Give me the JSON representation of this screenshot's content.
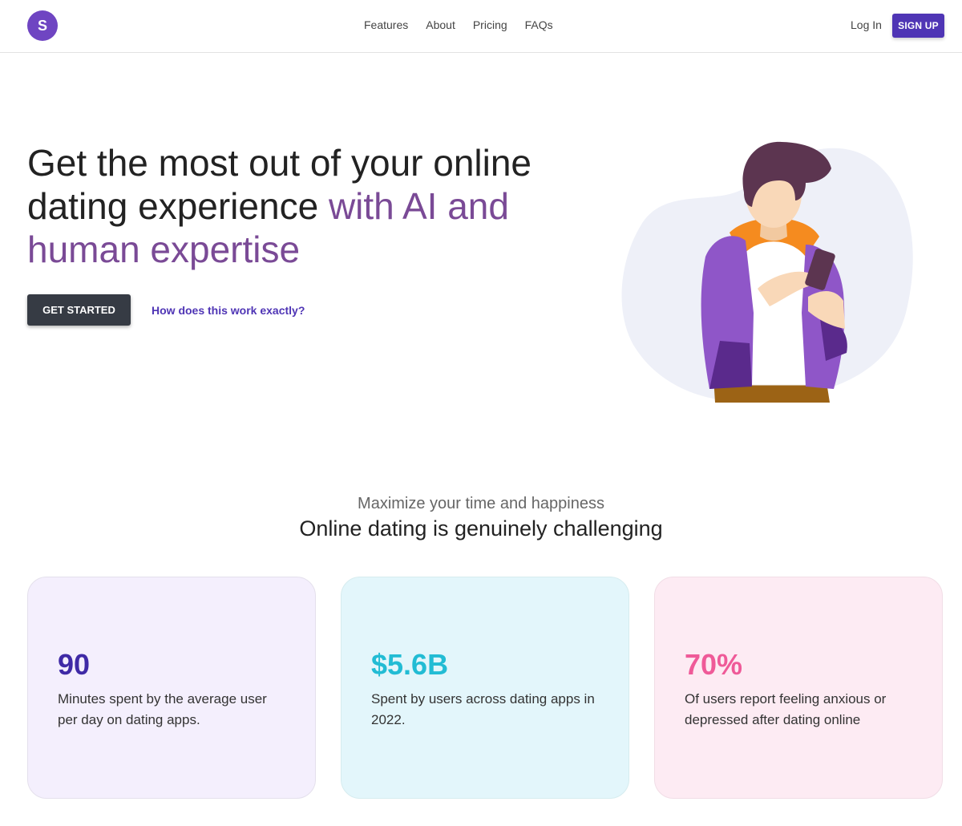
{
  "brand": {
    "logo_letter": "S",
    "accent_color": "#6f45c2"
  },
  "nav": {
    "links": [
      "Features",
      "About",
      "Pricing",
      "FAQs"
    ],
    "login_label": "Log In",
    "signup_label": "SIGN UP"
  },
  "hero": {
    "title_plain": "Get the most out of your online dating experience ",
    "title_accent": "with AI and human expertise",
    "cta_label": "GET STARTED",
    "secondary_link": "How does this work exactly?",
    "illustration": "person-holding-phone-illustration"
  },
  "section": {
    "subtitle": "Maximize your time and happiness",
    "title": "Online dating is genuinely challenging"
  },
  "stats": [
    {
      "value": "90",
      "text": "Minutes spent by the average user per day on dating apps.",
      "color": "#3f2aa6"
    },
    {
      "value": "$5.6B",
      "text": "Spent by users across dating apps in 2022.",
      "color": "#22bcd4"
    },
    {
      "value": "70%",
      "text": "Of users report feeling anxious or depressed after dating online",
      "color": "#ef5a98"
    }
  ]
}
